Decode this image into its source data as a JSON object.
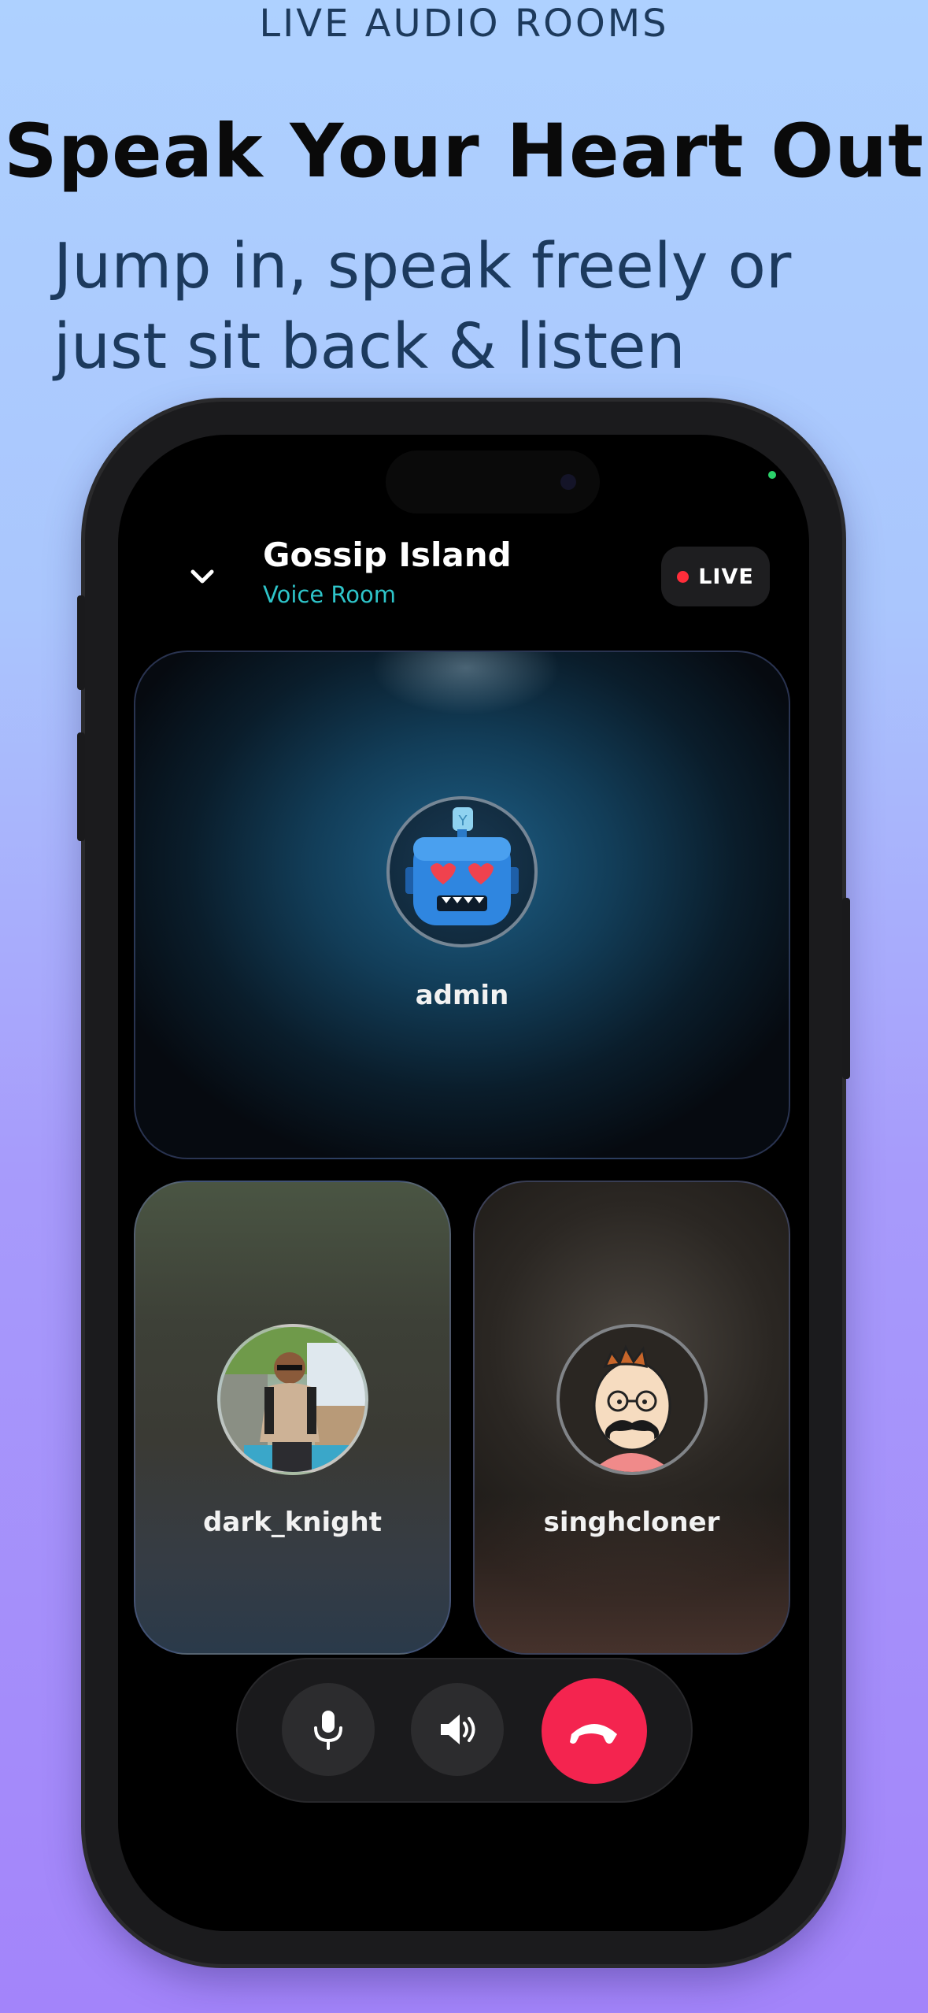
{
  "promo": {
    "eyebrow": "LIVE AUDIO ROOMS",
    "headline": "Speak Your Heart Out",
    "subhead": "Jump in, speak freely or just sit back & listen"
  },
  "room": {
    "title": "Gossip Island",
    "subtitle": "Voice Room",
    "live_label": "LIVE",
    "back_icon": "chevron-down-icon"
  },
  "participants": [
    {
      "name": "admin",
      "avatar": "robot-heart-eyes-avatar"
    },
    {
      "name": "dark_knight",
      "avatar": "photo-avatar"
    },
    {
      "name": "singhcloner",
      "avatar": "mustache-cartoon-avatar"
    }
  ],
  "controls": {
    "mic_icon": "microphone-icon",
    "speaker_icon": "speaker-icon",
    "end_icon": "hang-up-icon"
  },
  "colors": {
    "accent_teal": "#2ec4c9",
    "live_red": "#ff2d3a",
    "end_call": "#f4244f"
  }
}
